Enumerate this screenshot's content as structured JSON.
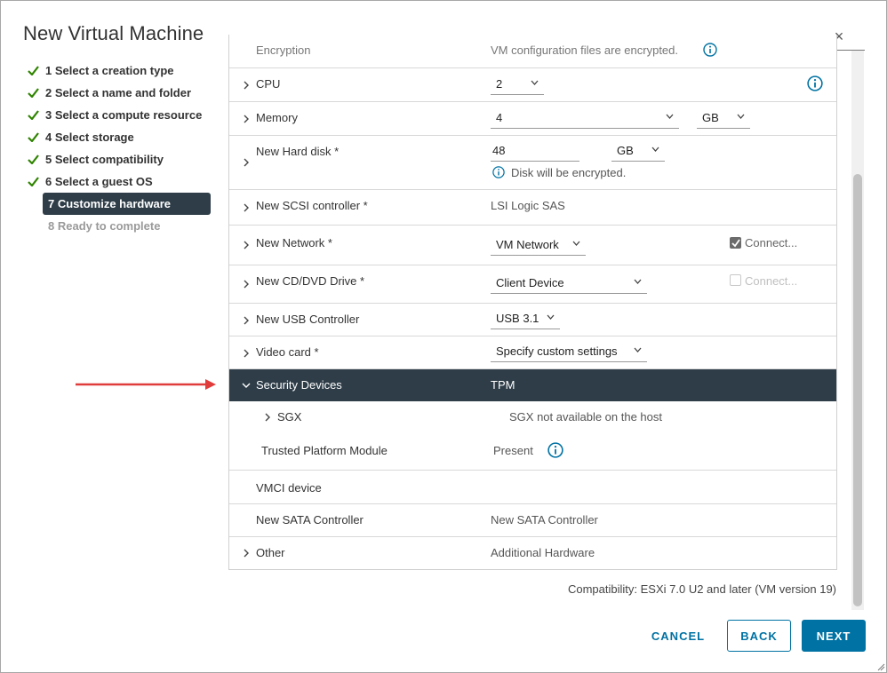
{
  "dialog": {
    "title": "New Virtual Machine",
    "close_label": "×"
  },
  "steps": [
    {
      "label": "1 Select a creation type",
      "state": "done"
    },
    {
      "label": "2 Select a name and folder",
      "state": "done"
    },
    {
      "label": "3 Select a compute resource",
      "state": "done"
    },
    {
      "label": "4 Select storage",
      "state": "done"
    },
    {
      "label": "5 Select compatibility",
      "state": "done"
    },
    {
      "label": "6 Select a guest OS",
      "state": "done"
    },
    {
      "label": "7 Customize hardware",
      "state": "active"
    },
    {
      "label": "8 Ready to complete",
      "state": "disabled"
    }
  ],
  "hardware": {
    "encryption": {
      "label": "Encryption",
      "value": "VM configuration files are encrypted."
    },
    "cpu": {
      "label": "CPU",
      "value": "2"
    },
    "memory": {
      "label": "Memory",
      "value": "4",
      "unit": "GB"
    },
    "hard_disk": {
      "label": "New Hard disk *",
      "value": "48",
      "unit": "GB",
      "note": "Disk will be encrypted."
    },
    "scsi": {
      "label": "New SCSI controller *",
      "value": "LSI Logic SAS"
    },
    "network": {
      "label": "New Network *",
      "value": "VM Network",
      "connect_label": "Connect..."
    },
    "cd_dvd": {
      "label": "New CD/DVD Drive *",
      "value": "Client Device",
      "connect_label": "Connect..."
    },
    "usb": {
      "label": "New USB Controller",
      "value": "USB 3.1"
    },
    "video": {
      "label": "Video card *",
      "value": "Specify custom settings"
    },
    "security": {
      "label": "Security Devices",
      "value": "TPM"
    },
    "sgx": {
      "label": "SGX",
      "value": "SGX not available on the host"
    },
    "tpm": {
      "label": "Trusted Platform Module",
      "value": "Present"
    },
    "vmci": {
      "label": "VMCI device",
      "value": ""
    },
    "sata": {
      "label": "New SATA Controller",
      "value": "New SATA Controller"
    },
    "other": {
      "label": "Other",
      "value": "Additional Hardware"
    }
  },
  "compatibility": "Compatibility: ESXi 7.0 U2 and later (VM version 19)",
  "buttons": {
    "cancel": "CANCEL",
    "back": "BACK",
    "next": "NEXT"
  },
  "colors": {
    "accent": "#0072a3",
    "selected_row": "#2e3d48",
    "check_green": "#2f8400",
    "arrow_red": "#e03c3c"
  }
}
